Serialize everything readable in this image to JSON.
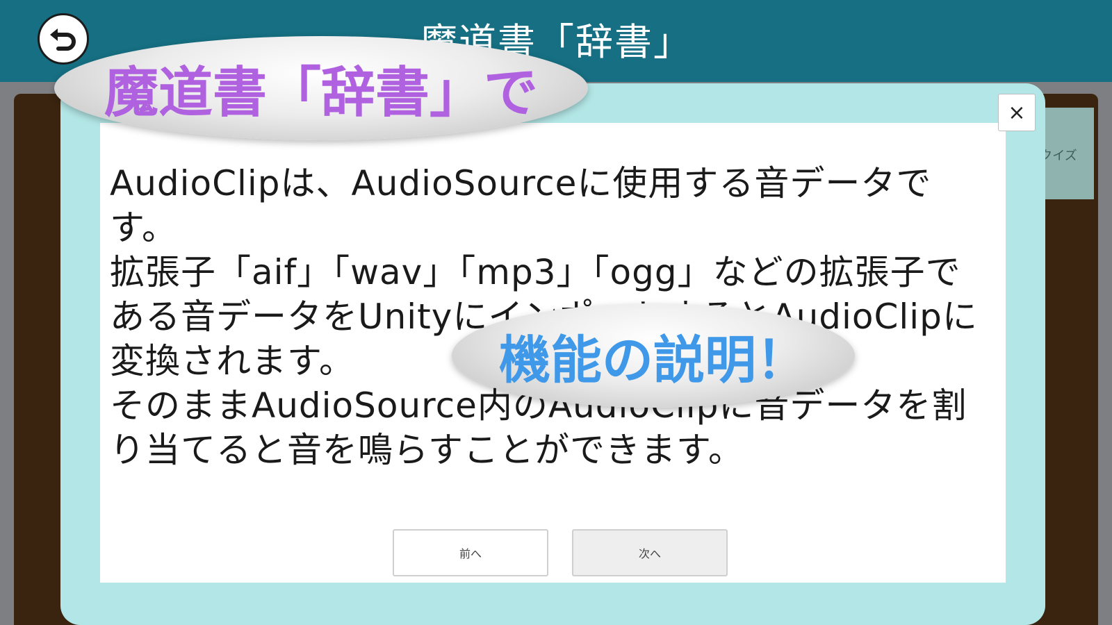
{
  "header": {
    "title": "魔道書「辞書」",
    "back_icon": "back-arrow-icon"
  },
  "side_tab": {
    "label": "クイズ"
  },
  "dialog": {
    "body": "AudioClipは、AudioSourceに使用する音データです。\n拡張子「aif」「wav」「mp3」「ogg」などの拡張子である音データをUnityにインポートするとAudioClipに変換されます。\nそのままAudioSource内のAudioClipに音データを割り当てると音を鳴らすことができます。",
    "close_label": "×",
    "prev_label": "前へ",
    "next_label": "次へ"
  },
  "overlay": {
    "top_caption": "魔道書「辞書」で",
    "mid_caption": "機能の説明！"
  },
  "colors": {
    "header_bg": "#166f82",
    "dialog_bg": "#b3e6e6",
    "board_bg": "#3a2410",
    "caption_purple": "#b061df",
    "caption_blue": "#3f99e8"
  }
}
